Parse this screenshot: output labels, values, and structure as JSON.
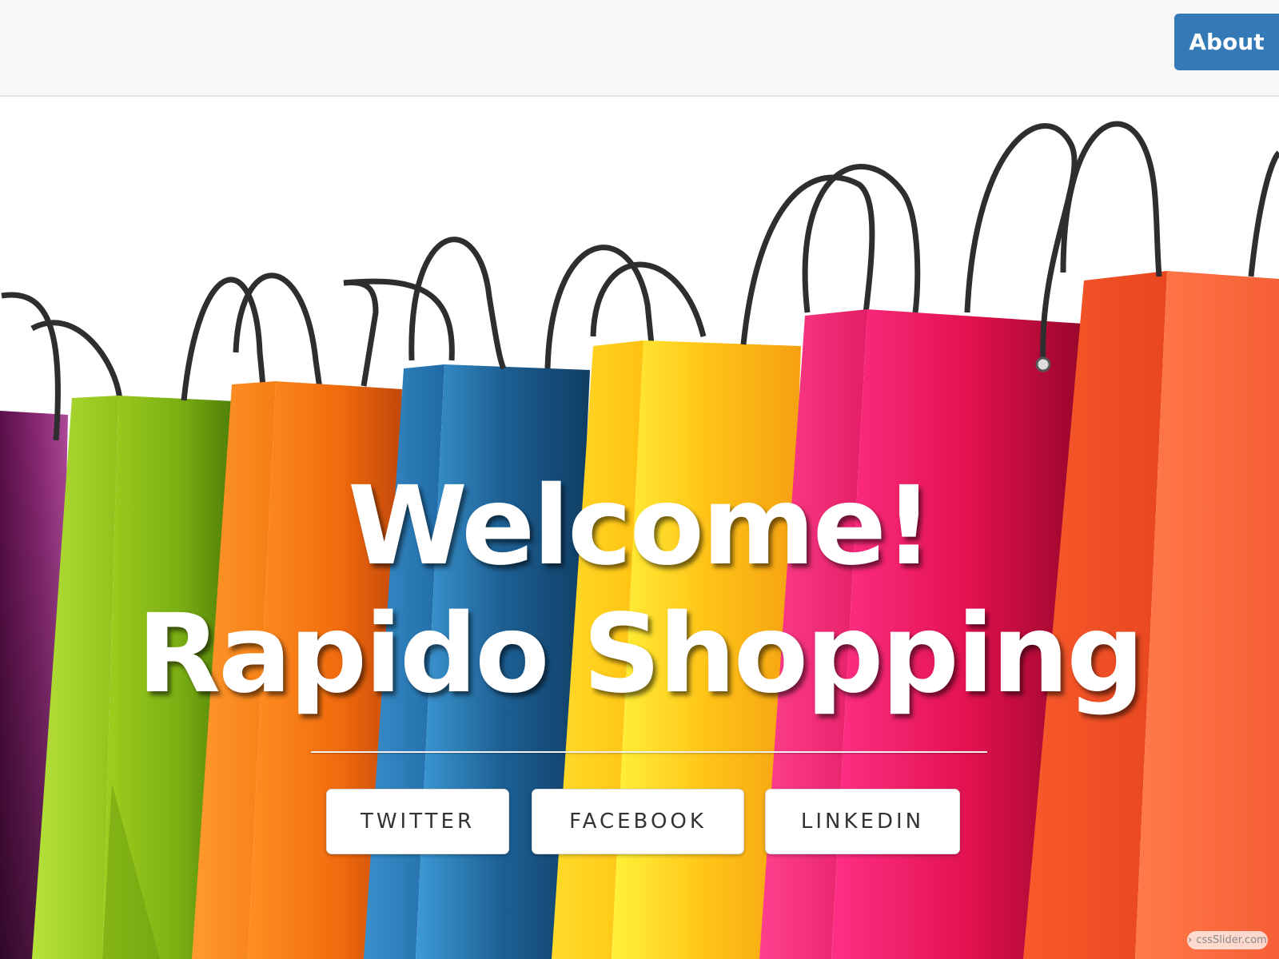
{
  "navbar": {
    "about_label": "About"
  },
  "hero": {
    "headline_line1": "Welcome!",
    "headline_line2": "Rapido Shopping",
    "buttons": [
      {
        "label": "TWITTER"
      },
      {
        "label": "FACEBOOK"
      },
      {
        "label": "LINKEDIN"
      }
    ]
  },
  "watermark": {
    "text": "cssSlider.com",
    "icon": "chevron-right-icon"
  },
  "colors": {
    "about_button": "#337ab7",
    "navbar_bg": "#f7f7f7",
    "bag_purple": "#7a1f66",
    "bag_green": "#9ccc1c",
    "bag_orange": "#f7851f",
    "bag_blue": "#2478b4",
    "bag_yellow": "#ffd21a",
    "bag_pink": "#ef1f6e",
    "bag_red_orange": "#f2552c"
  }
}
